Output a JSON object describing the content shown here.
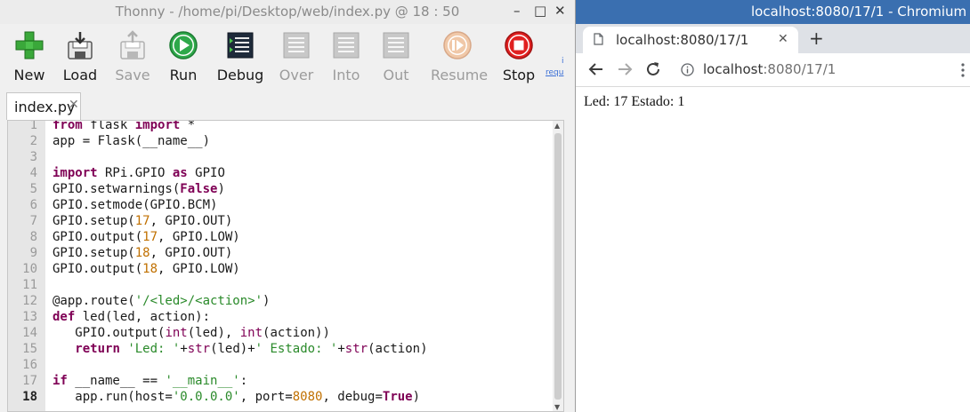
{
  "thonny": {
    "title": "Thonny  -  /home/pi/Desktop/web/index.py  @  18 : 50",
    "window_controls": {
      "minimize": "–",
      "maximize": "□",
      "close": "✕"
    },
    "toolbar": [
      {
        "label": "New",
        "icon": "new-file-icon",
        "enabled": true
      },
      {
        "label": "Load",
        "icon": "load-icon",
        "enabled": true
      },
      {
        "label": "Save",
        "icon": "save-icon",
        "enabled": false
      },
      {
        "label": "Run",
        "icon": "run-icon",
        "enabled": true
      },
      {
        "label": "Debug",
        "icon": "debug-icon",
        "enabled": true
      },
      {
        "label": "Over",
        "icon": "step-over-icon",
        "enabled": false
      },
      {
        "label": "Into",
        "icon": "step-into-icon",
        "enabled": false
      },
      {
        "label": "Out",
        "icon": "step-out-icon",
        "enabled": false
      },
      {
        "label": "Resume",
        "icon": "resume-icon",
        "enabled": false
      },
      {
        "label": "Stop",
        "icon": "stop-icon",
        "enabled": true
      }
    ],
    "toolbar_link": "requ",
    "toolbar_link_mark": "i",
    "tab": {
      "label": "index.py",
      "close": "✕"
    },
    "editor": {
      "current_line": 18,
      "lines": [
        "from flask import *",
        "app = Flask(__name__)",
        "",
        "import RPi.GPIO as GPIO",
        "GPIO.setwarnings(False)",
        "GPIO.setmode(GPIO.BCM)",
        "GPIO.setup(17, GPIO.OUT)",
        "GPIO.output(17, GPIO.LOW)",
        "GPIO.setup(18, GPIO.OUT)",
        "GPIO.output(18, GPIO.LOW)",
        "",
        "@app.route('/<led>/<action>')",
        "def led(led, action):",
        "   GPIO.output(int(led), int(action))",
        "   return 'Led: '+str(led)+' Estado: '+str(action)",
        "",
        "if __name__ == '__main__':",
        "   app.run(host='0.0.0.0', port=8080, debug=True)"
      ]
    }
  },
  "chromium": {
    "window_title": "localhost:8080/17/1 - Chromium",
    "tab_title": "localhost:8080/17/1",
    "tab_close": "✕",
    "new_tab": "+",
    "url_host": "localhost",
    "url_rest": ":8080/17/1",
    "page_text": "Led: 17 Estado: 1"
  },
  "colors": {
    "keyword": "#7f0055",
    "string": "#2a8a2a",
    "number": "#c07000",
    "chromium_titlebar": "#3a6fb0"
  }
}
